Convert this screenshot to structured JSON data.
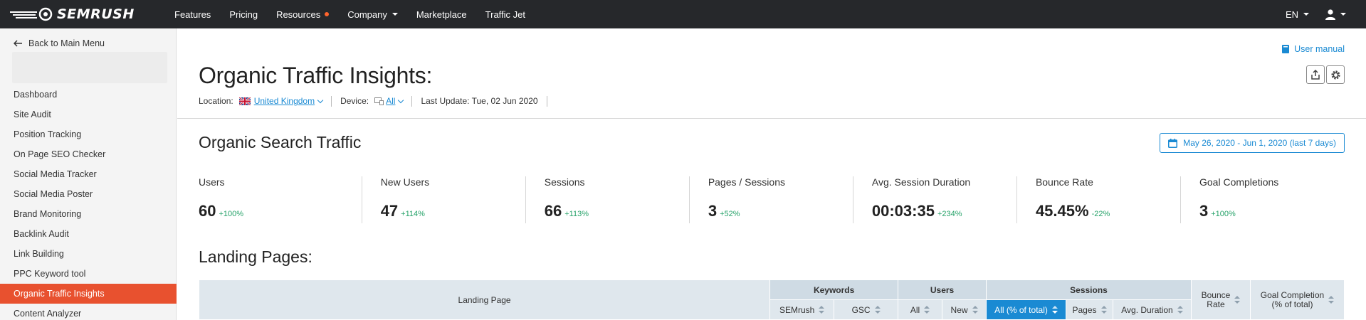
{
  "topbar": {
    "logo_text": "SEMRUSH",
    "nav": [
      {
        "label": "Features",
        "dot": false,
        "caret": false
      },
      {
        "label": "Pricing",
        "dot": false,
        "caret": false
      },
      {
        "label": "Resources",
        "dot": true,
        "caret": false
      },
      {
        "label": "Company",
        "dot": false,
        "caret": true
      },
      {
        "label": "Marketplace",
        "dot": false,
        "caret": false
      },
      {
        "label": "Traffic Jet",
        "dot": false,
        "caret": false
      }
    ],
    "language": "EN",
    "user_icon": "user-icon"
  },
  "sidebar": {
    "back_label": "Back to Main Menu",
    "items": [
      {
        "label": "Dashboard",
        "active": false
      },
      {
        "label": "Site Audit",
        "active": false
      },
      {
        "label": "Position Tracking",
        "active": false
      },
      {
        "label": "On Page SEO Checker",
        "active": false
      },
      {
        "label": "Social Media Tracker",
        "active": false
      },
      {
        "label": "Social Media Poster",
        "active": false
      },
      {
        "label": "Brand Monitoring",
        "active": false
      },
      {
        "label": "Backlink Audit",
        "active": false
      },
      {
        "label": "Link Building",
        "active": false
      },
      {
        "label": "PPC Keyword tool",
        "active": false
      },
      {
        "label": "Organic Traffic Insights",
        "active": true
      },
      {
        "label": "Content Analyzer",
        "active": false
      }
    ]
  },
  "header": {
    "user_manual": "User manual",
    "title": "Organic Traffic Insights:",
    "location_label": "Location:",
    "location_value": "United Kingdom",
    "device_label": "Device:",
    "device_value": "All",
    "last_update": "Last Update: Tue, 02 Jun 2020"
  },
  "traffic": {
    "title": "Organic Search Traffic",
    "date_range": "May 26, 2020 - Jun 1, 2020 (last 7 days)",
    "kpis": [
      {
        "label": "Users",
        "value": "60",
        "delta": "+100%"
      },
      {
        "label": "New Users",
        "value": "47",
        "delta": "+114%"
      },
      {
        "label": "Sessions",
        "value": "66",
        "delta": "+113%"
      },
      {
        "label": "Pages / Sessions",
        "value": "3",
        "delta": "+52%"
      },
      {
        "label": "Avg. Session Duration",
        "value": "00:03:35",
        "delta": "+234%"
      },
      {
        "label": "Bounce Rate",
        "value": "45.45%",
        "delta": "-22%"
      },
      {
        "label": "Goal Completions",
        "value": "3",
        "delta": "+100%"
      }
    ]
  },
  "landing": {
    "title": "Landing Pages:",
    "col_landing_page": "Landing Page",
    "grp_keywords": "Keywords",
    "grp_users": "Users",
    "grp_sessions": "Sessions",
    "col_semrush": "SEMrush",
    "col_gsc": "GSC",
    "col_users_all": "All",
    "col_users_new": "New",
    "col_sessions_all": "All (% of total)",
    "col_pages": "Pages",
    "col_avg_duration": "Avg. Duration",
    "col_bounce_1": "Bounce",
    "col_bounce_2": "Rate",
    "col_goal_1": "Goal Completion",
    "col_goal_2": "(% of total)"
  }
}
